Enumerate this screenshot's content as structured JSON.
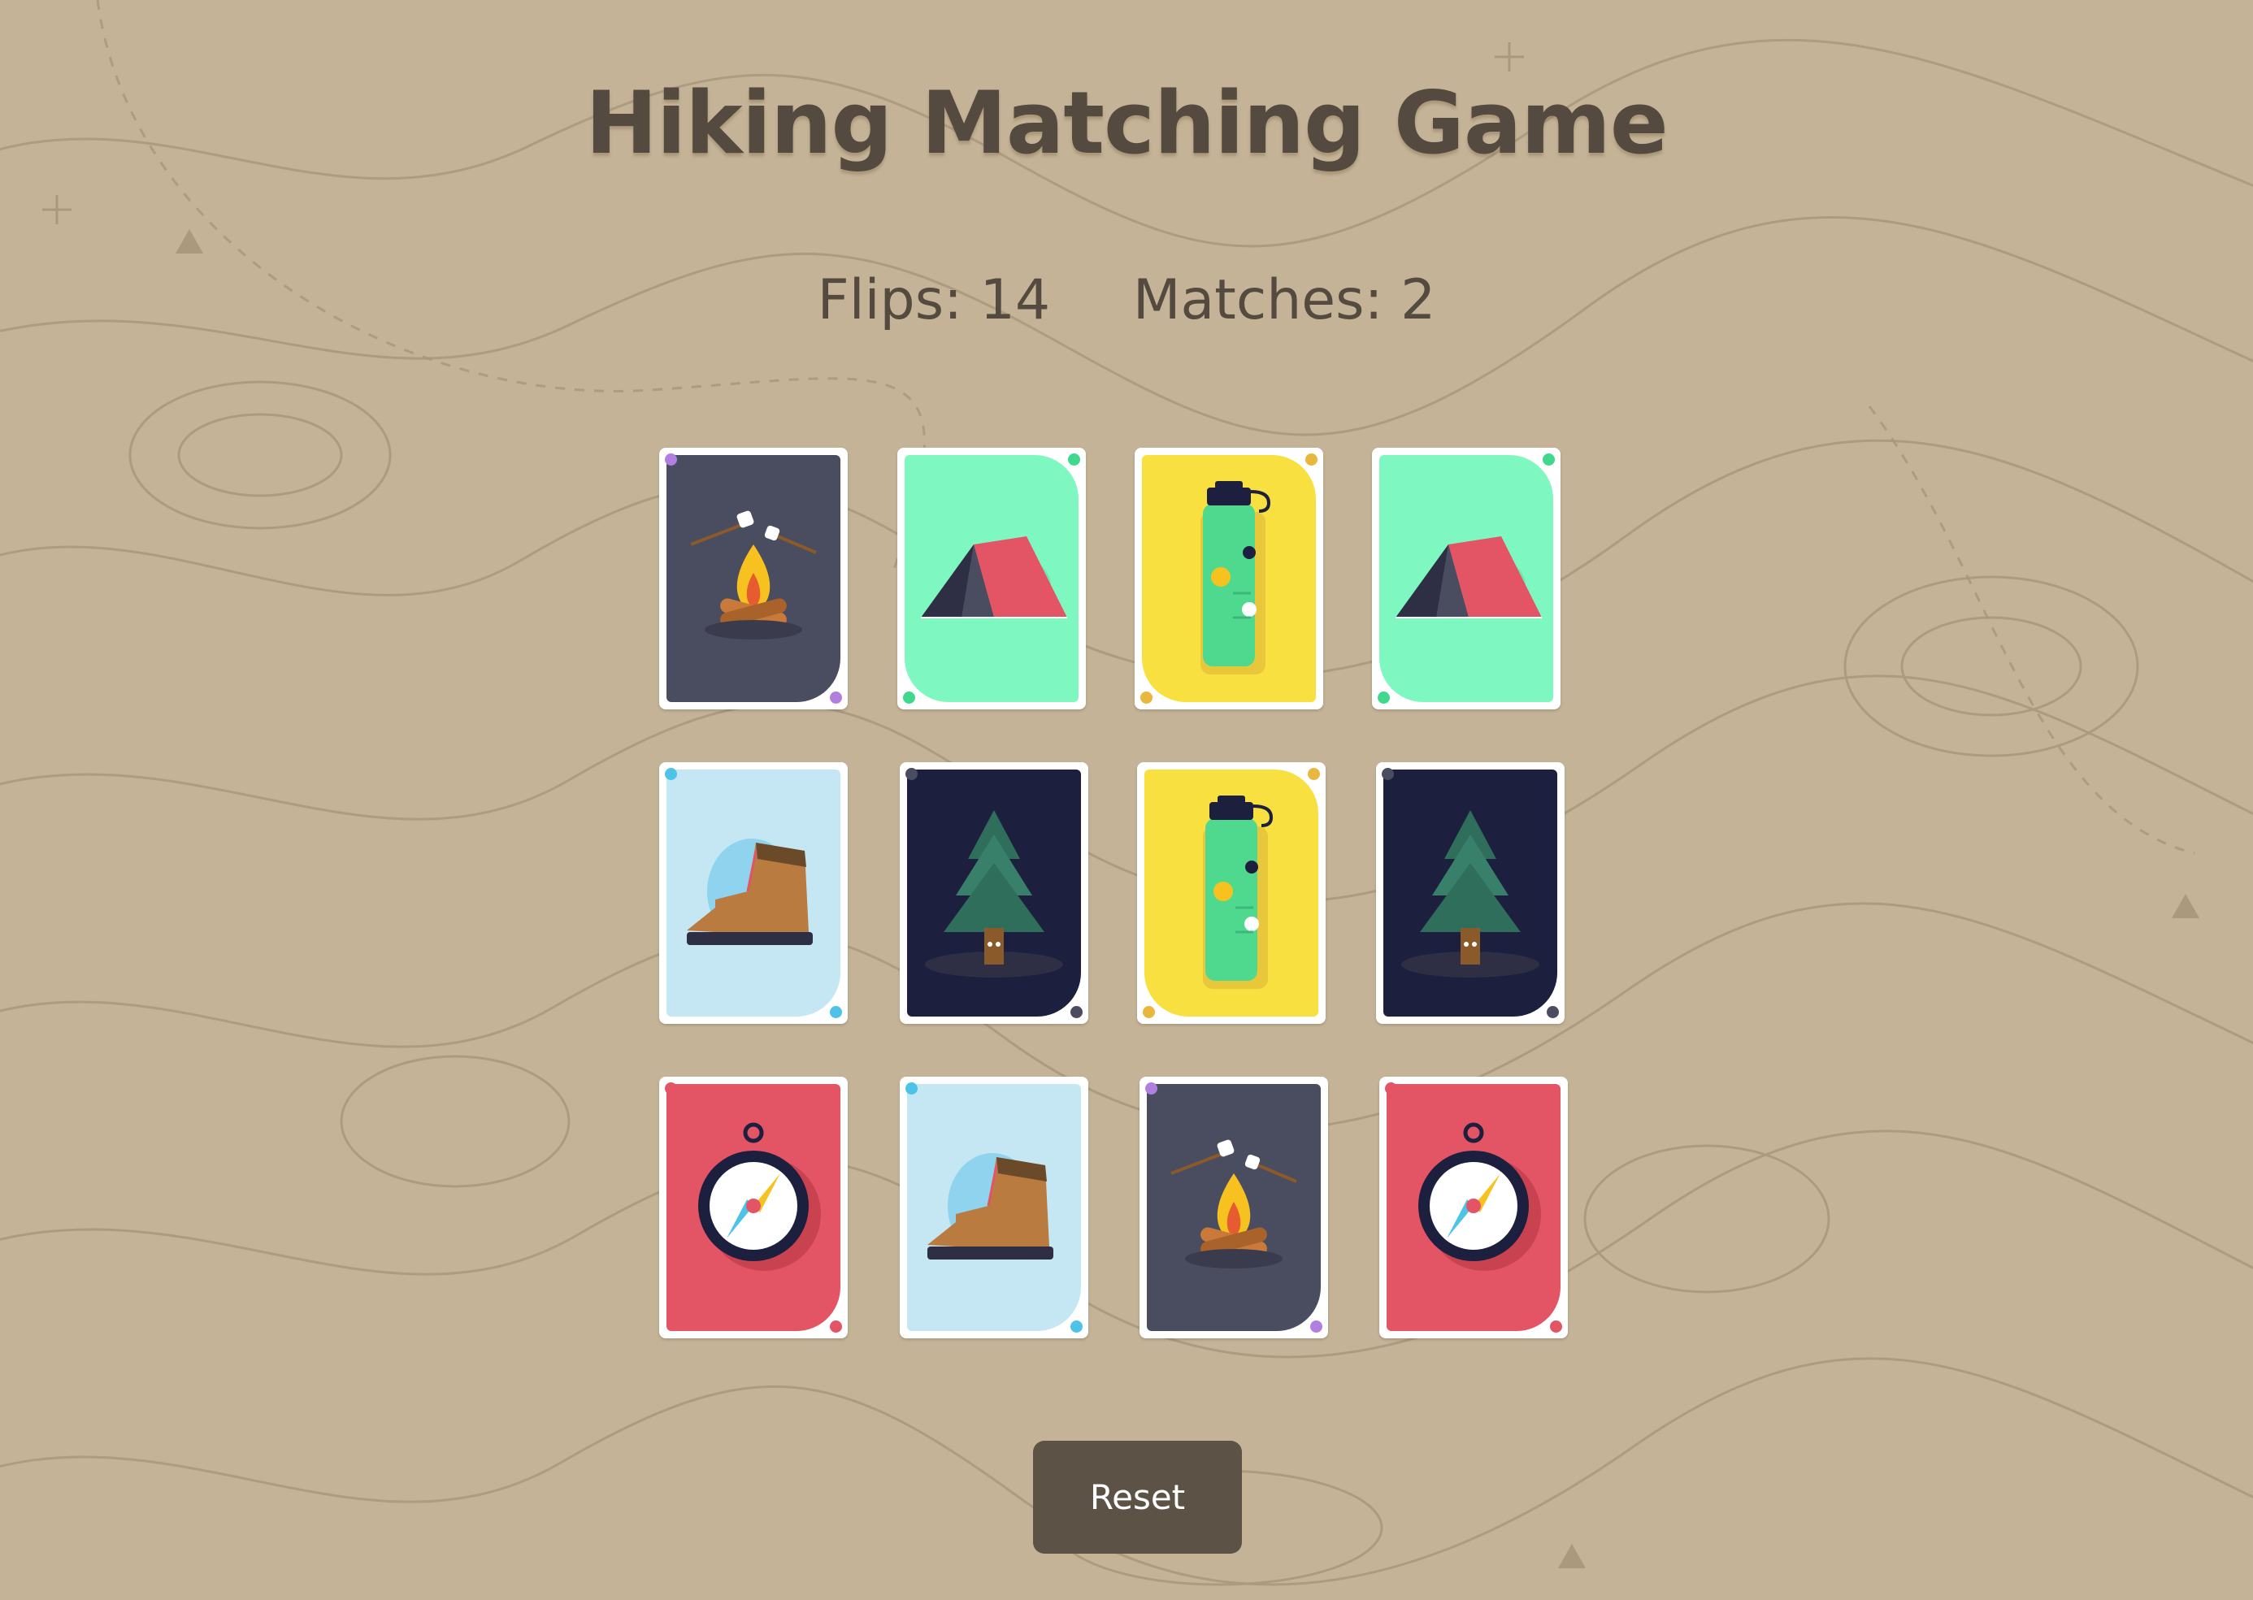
{
  "title": "Hiking Matching Game",
  "stats": {
    "flips_text": "Flips: 14",
    "matches_text": "Matches: 2"
  },
  "reset_label": "Reset",
  "colors": {
    "background": "#c4b396",
    "text": "#544a3f",
    "button": "#5c5246"
  },
  "cards": [
    {
      "icon": "campfire-icon",
      "face": "#4a4c5f",
      "dot": "#b17fe0",
      "corner": "right"
    },
    {
      "icon": "tent-icon",
      "face": "#7ff7c1",
      "dot": "#3fd88c",
      "corner": "left"
    },
    {
      "icon": "water-bottle-icon",
      "face": "#f7e03f",
      "dot": "#e8b73f",
      "corner": "left"
    },
    {
      "icon": "tent-icon",
      "face": "#7ff7c1",
      "dot": "#3fd88c",
      "corner": "left"
    },
    {
      "icon": "hiking-boot-icon",
      "face": "#c5e7f3",
      "dot": "#4ec3e8",
      "corner": "right"
    },
    {
      "icon": "pine-tree-icon",
      "face": "#1d1f3f",
      "dot": "#4a4c5f",
      "corner": "right"
    },
    {
      "icon": "water-bottle-icon",
      "face": "#f7e03f",
      "dot": "#e8b73f",
      "corner": "left"
    },
    {
      "icon": "pine-tree-icon",
      "face": "#1d1f3f",
      "dot": "#4a4c5f",
      "corner": "right"
    },
    {
      "icon": "compass-icon",
      "face": "#e35464",
      "dot": "#e35464",
      "corner": "right"
    },
    {
      "icon": "hiking-boot-icon",
      "face": "#c5e7f3",
      "dot": "#4ec3e8",
      "corner": "right"
    },
    {
      "icon": "campfire-icon",
      "face": "#4a4c5f",
      "dot": "#b17fe0",
      "corner": "right"
    },
    {
      "icon": "compass-icon",
      "face": "#e35464",
      "dot": "#e35464",
      "corner": "right"
    }
  ]
}
